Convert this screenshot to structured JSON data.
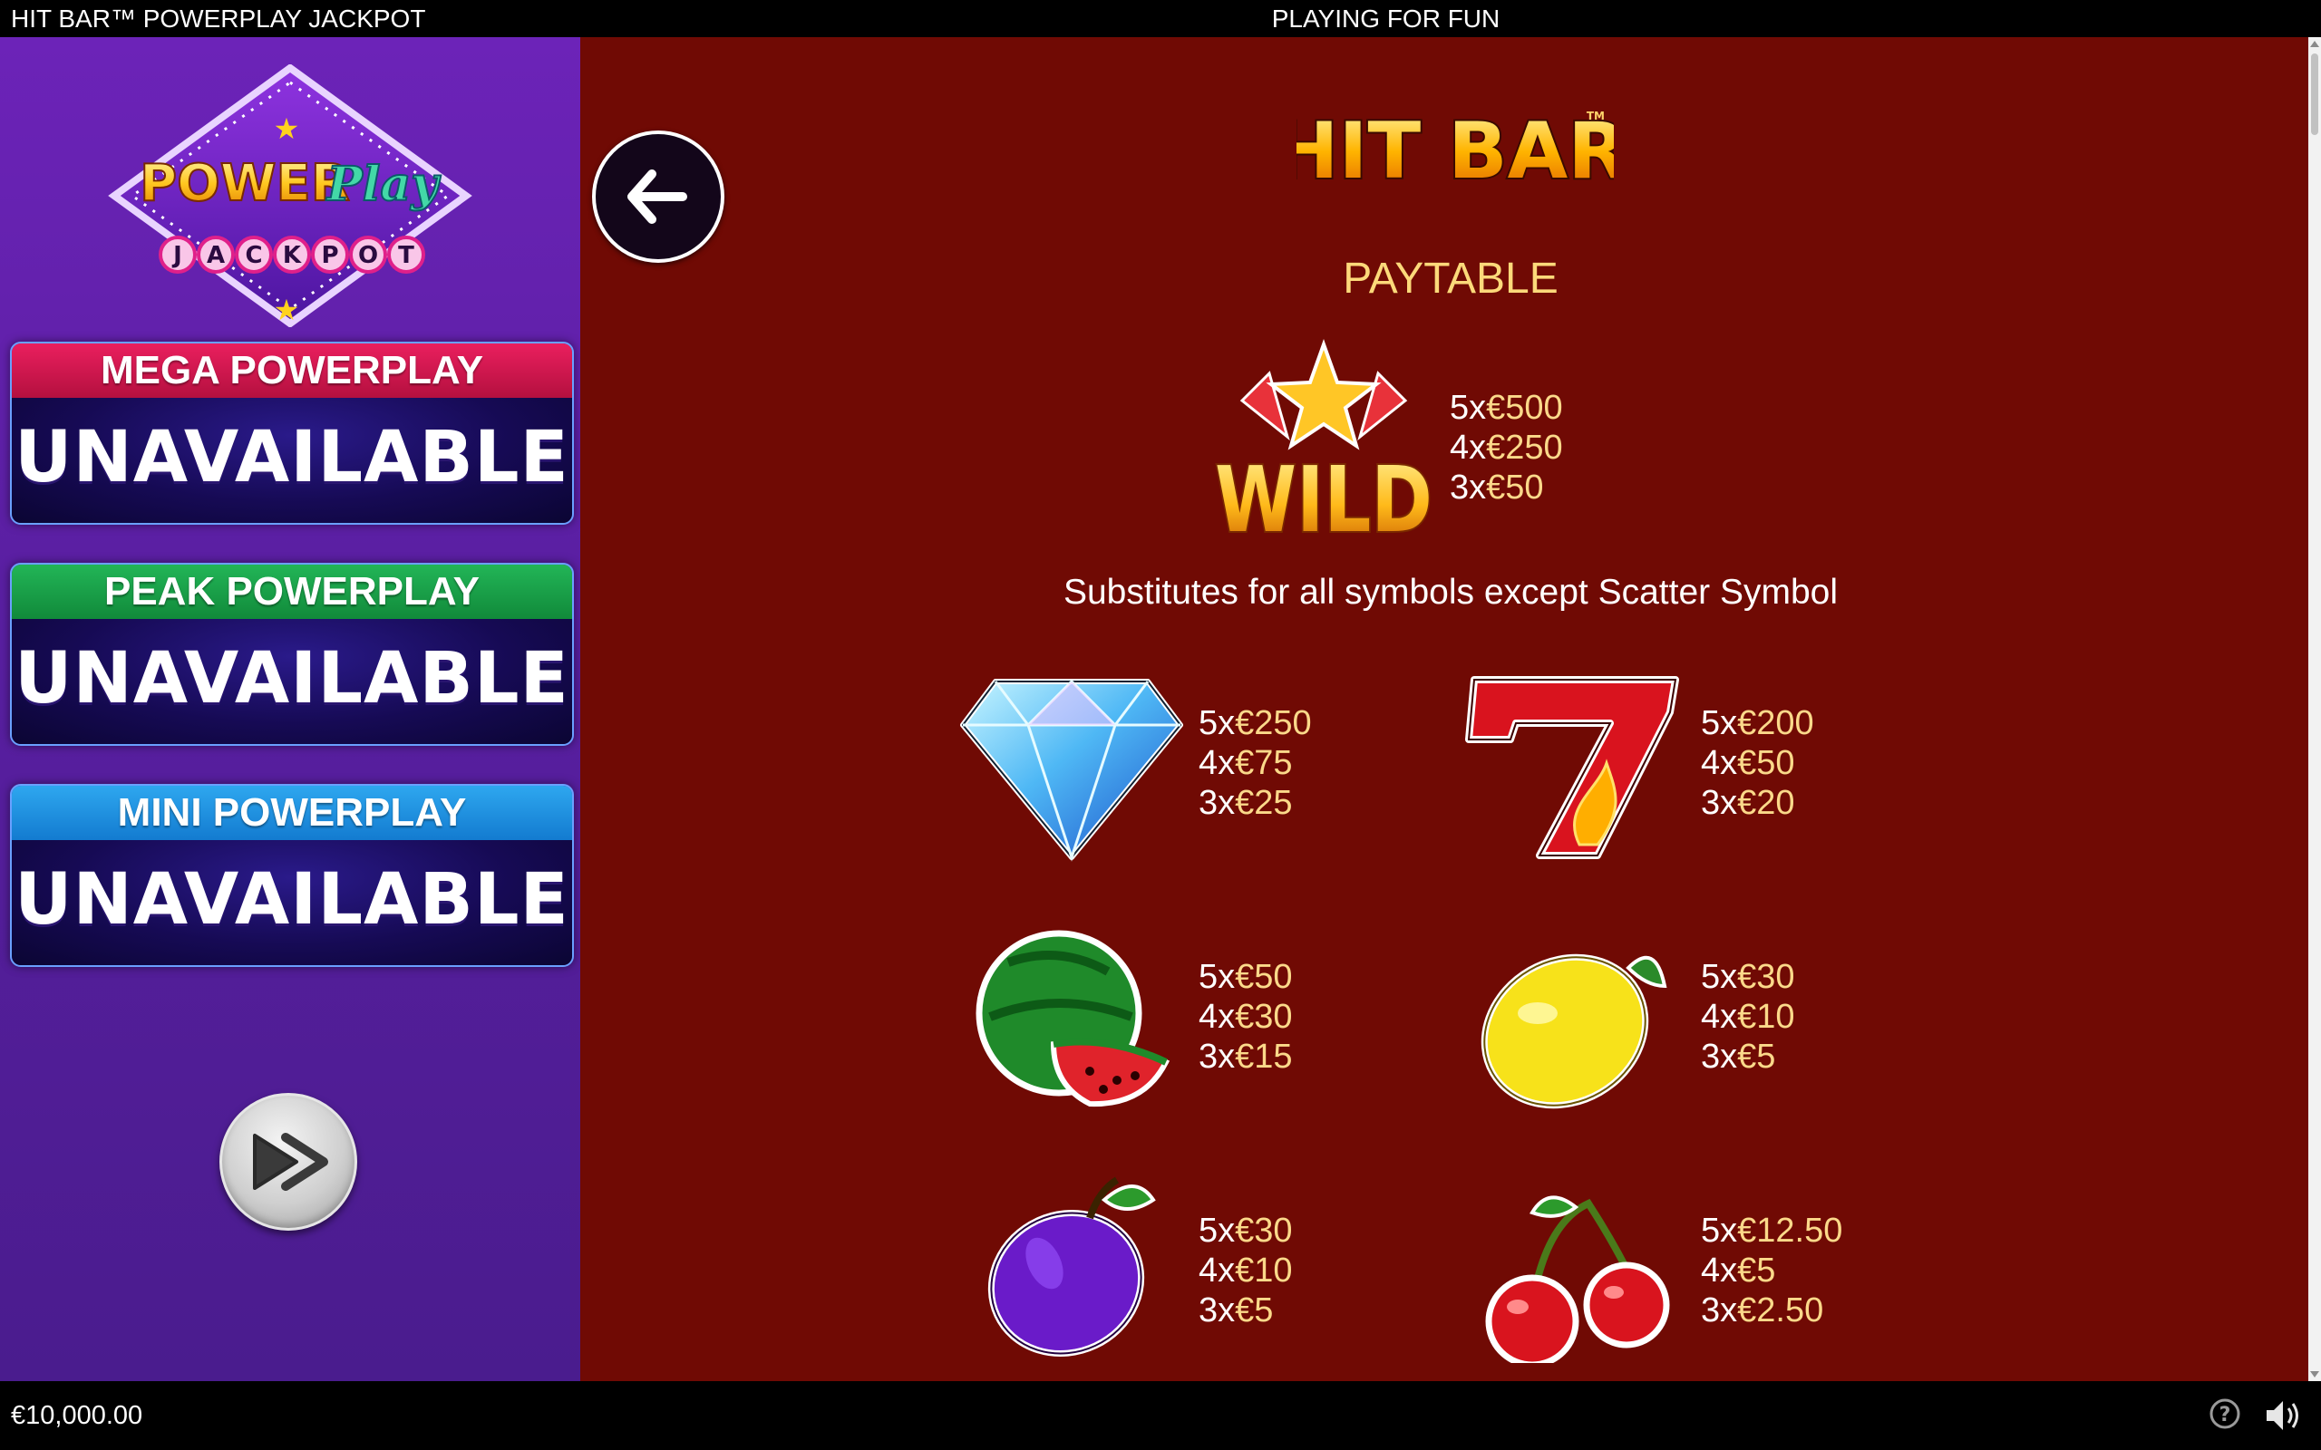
{
  "top_bar": {
    "title": "HIT BAR™ POWERPLAY JACKPOT",
    "mode": "PLAYING FOR FUN"
  },
  "bottom_bar": {
    "balance": "€10,000.00",
    "help_icon": "question-circle-icon",
    "sound_icon": "speaker-icon"
  },
  "left_panel": {
    "logo": {
      "line1": "POWER",
      "line2": "Play",
      "line3": "JACKPOT"
    },
    "jackpots": [
      {
        "name": "MEGA POWERPLAY",
        "status": "UNAVAILABLE",
        "color": "#e01a57"
      },
      {
        "name": "PEAK POWERPLAY",
        "status": "UNAVAILABLE",
        "color": "#1ca84f"
      },
      {
        "name": "MINI POWERPLAY",
        "status": "UNAVAILABLE",
        "color": "#219bea"
      }
    ],
    "play_icon": "fast-forward-icon"
  },
  "main": {
    "back_icon": "arrow-left-icon",
    "logo_text": "HIT BAR",
    "logo_tm": "TM",
    "heading": "PAYTABLE",
    "wild": {
      "label": "WILD",
      "pays": [
        {
          "mult": "5x",
          "amount": "€500"
        },
        {
          "mult": "4x",
          "amount": "€250"
        },
        {
          "mult": "3x",
          "amount": "€50"
        }
      ],
      "description": "Substitutes for all symbols except Scatter Symbol"
    },
    "symbols": [
      {
        "name": "diamond",
        "pays": [
          {
            "mult": "5x",
            "amount": "€250"
          },
          {
            "mult": "4x",
            "amount": "€75"
          },
          {
            "mult": "3x",
            "amount": "€25"
          }
        ]
      },
      {
        "name": "seven",
        "pays": [
          {
            "mult": "5x",
            "amount": "€200"
          },
          {
            "mult": "4x",
            "amount": "€50"
          },
          {
            "mult": "3x",
            "amount": "€20"
          }
        ]
      },
      {
        "name": "watermelon",
        "pays": [
          {
            "mult": "5x",
            "amount": "€50"
          },
          {
            "mult": "4x",
            "amount": "€30"
          },
          {
            "mult": "3x",
            "amount": "€15"
          }
        ]
      },
      {
        "name": "lemon",
        "pays": [
          {
            "mult": "5x",
            "amount": "€30"
          },
          {
            "mult": "4x",
            "amount": "€10"
          },
          {
            "mult": "3x",
            "amount": "€5"
          }
        ]
      },
      {
        "name": "plum",
        "pays": [
          {
            "mult": "5x",
            "amount": "€30"
          },
          {
            "mult": "4x",
            "amount": "€10"
          },
          {
            "mult": "3x",
            "amount": "€5"
          }
        ]
      },
      {
        "name": "cherry",
        "pays": [
          {
            "mult": "5x",
            "amount": "€12.50"
          },
          {
            "mult": "4x",
            "amount": "€5"
          },
          {
            "mult": "3x",
            "amount": "€2.50"
          }
        ]
      }
    ]
  }
}
